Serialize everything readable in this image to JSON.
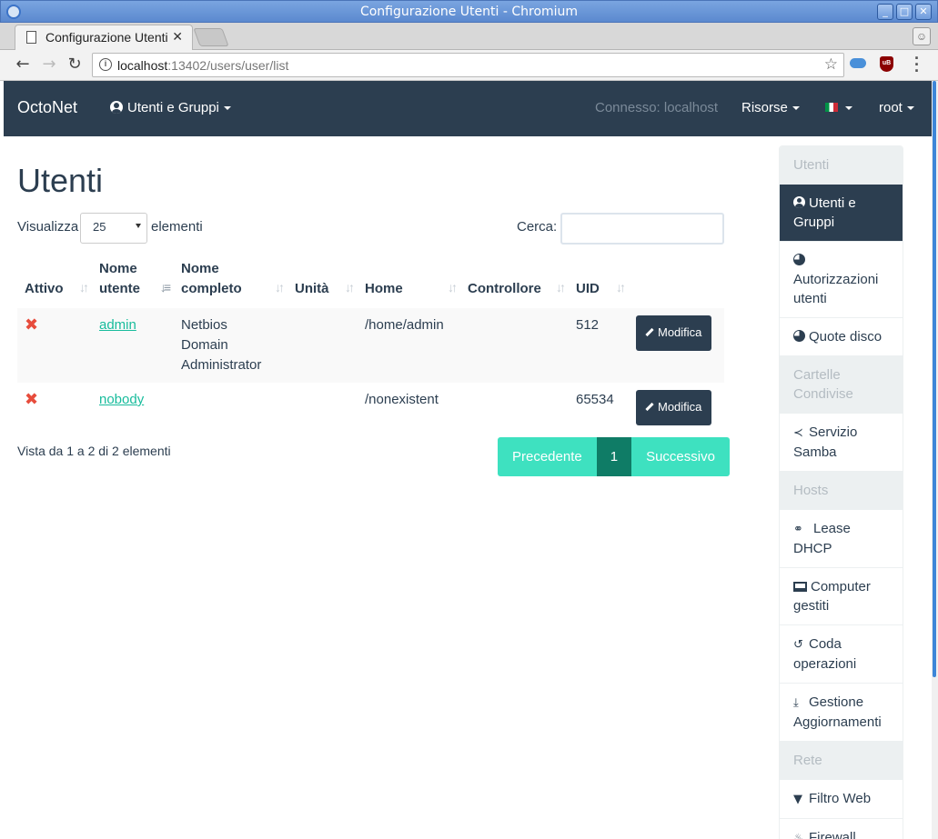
{
  "window": {
    "title": "Configurazione Utenti - Chromium",
    "tab_title": "Configurazione Utenti",
    "url_host": "localhost",
    "url_rest": ":13402/users/user/list",
    "ext_badge": "uB"
  },
  "navbar": {
    "brand": "OctoNet",
    "users_menu": "Utenti e Gruppi",
    "connected": "Connesso: localhost",
    "resources": "Risorse",
    "user": "root"
  },
  "page": {
    "title": "Utenti",
    "show_label": "Visualizza",
    "page_length": "25",
    "elements_label": "elementi",
    "search_label": "Cerca:",
    "search_value": "",
    "info": "Vista da 1 a 2 di 2 elementi"
  },
  "table": {
    "headers": {
      "active": "Attivo",
      "username_1": "Nome",
      "username_2": "utente",
      "fullname_1": "Nome",
      "fullname_2": "completo",
      "drive": "Unità",
      "home": "Home",
      "controller": "Controllore",
      "uid": "UID"
    },
    "rows": [
      {
        "active": "✖",
        "username": "admin",
        "fullname_1": "Netbios",
        "fullname_2": "Domain",
        "fullname_3": "Administrator",
        "drive": "",
        "home": "/home/admin",
        "controller": "",
        "uid": "512",
        "action": "Modifica"
      },
      {
        "active": "✖",
        "username": "nobody",
        "fullname_1": "",
        "fullname_2": "",
        "fullname_3": "",
        "drive": "",
        "home": "/nonexistent",
        "controller": "",
        "uid": "65534",
        "action": "Modifica"
      }
    ]
  },
  "pagination": {
    "prev": "Precedente",
    "current": "1",
    "next": "Successivo"
  },
  "sidebar": {
    "sections": [
      {
        "header": "Utenti",
        "items": [
          {
            "label": "Utenti e Gruppi",
            "active": true
          },
          {
            "label": "Autorizzazioni utenti"
          },
          {
            "label": "Quote disco"
          }
        ]
      },
      {
        "header": "Cartelle Condivise",
        "items": [
          {
            "label": "Servizio Samba"
          }
        ]
      },
      {
        "header": "Hosts",
        "items": [
          {
            "label": "Lease DHCP"
          },
          {
            "label": "Computer gestiti"
          },
          {
            "label": "Coda operazioni"
          },
          {
            "label": "Gestione Aggiornamenti"
          }
        ]
      },
      {
        "header": "Rete",
        "items": [
          {
            "label": "Filtro Web"
          },
          {
            "label": "Firewall"
          }
        ]
      }
    ]
  },
  "colors": {
    "primary": "#2c3e50",
    "success": "#18bc9c",
    "danger": "#e74c3c",
    "pagination": "#3ee1c0"
  }
}
